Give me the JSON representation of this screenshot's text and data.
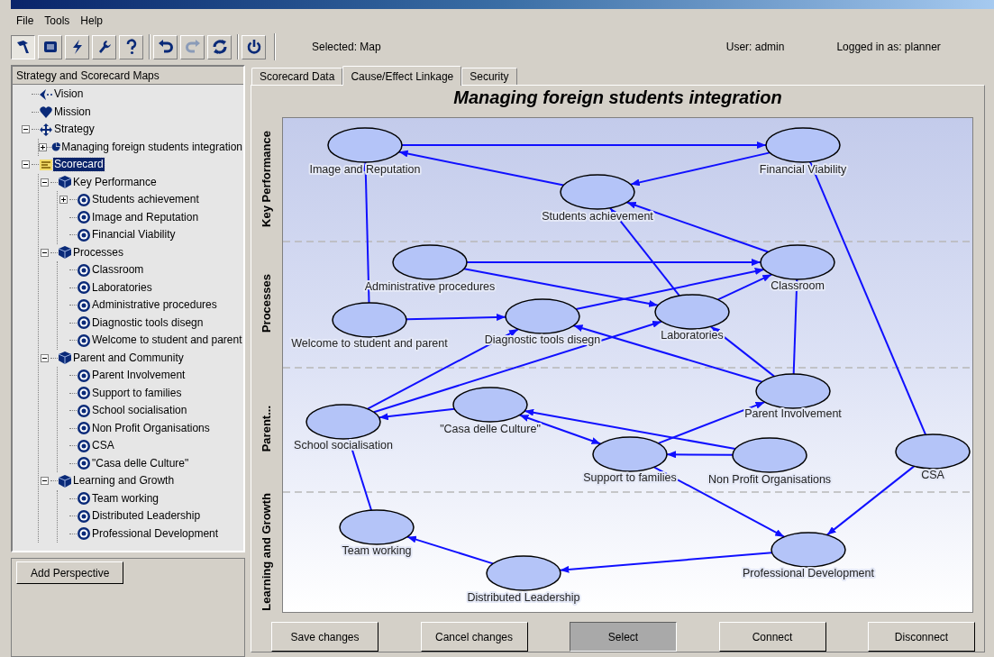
{
  "menu": [
    "File",
    "Tools",
    "Help"
  ],
  "toolbar": [
    {
      "kind": "hammer",
      "selected": true,
      "disabled": false
    },
    {
      "kind": "list",
      "selected": false,
      "disabled": false
    },
    {
      "kind": "bolt",
      "selected": false,
      "disabled": false
    },
    {
      "kind": "wrench",
      "selected": false,
      "disabled": false
    },
    {
      "kind": "help",
      "selected": false,
      "disabled": false
    },
    {
      "kind": "undo",
      "selected": false,
      "disabled": false
    },
    {
      "kind": "redo",
      "selected": false,
      "disabled": true
    },
    {
      "kind": "refresh",
      "selected": false,
      "disabled": false
    },
    {
      "kind": "power",
      "selected": false,
      "disabled": false
    }
  ],
  "status": {
    "selected": "Selected: Map",
    "user": "User: admin",
    "logged_in": "Logged in as: planner"
  },
  "sidebar": {
    "title": "Strategy and Scorecard Maps",
    "tree": [
      {
        "label": "Vision",
        "kind": "vision",
        "selected": false
      },
      {
        "label": "Mission",
        "kind": "mission",
        "selected": false
      },
      {
        "label": "Strategy",
        "kind": "strategy",
        "selected": false,
        "expanded": true,
        "children": [
          {
            "label": "Managing foreign students integration",
            "kind": "map",
            "selected": false,
            "expanded": false
          }
        ]
      },
      {
        "label": "Scorecard",
        "kind": "scorecard",
        "selected": true,
        "expanded": true,
        "children": [
          {
            "label": "Key Performance",
            "kind": "perspective",
            "selected": false,
            "expanded": true,
            "children": [
              {
                "label": "Students achievement",
                "kind": "objective",
                "selected": false,
                "expanded": false
              },
              {
                "label": "Image and Reputation",
                "kind": "objective",
                "selected": false
              },
              {
                "label": "Financial Viability",
                "kind": "objective",
                "selected": false
              }
            ]
          },
          {
            "label": "Processes",
            "kind": "perspective",
            "selected": false,
            "expanded": true,
            "children": [
              {
                "label": "Classroom",
                "kind": "objective",
                "selected": false
              },
              {
                "label": "Laboratories",
                "kind": "objective",
                "selected": false
              },
              {
                "label": "Administrative procedures",
                "kind": "objective",
                "selected": false
              },
              {
                "label": "Diagnostic tools disegn",
                "kind": "objective",
                "selected": false
              },
              {
                "label": "Welcome to student and parent",
                "kind": "objective",
                "selected": false
              }
            ]
          },
          {
            "label": "Parent and Community",
            "kind": "perspective",
            "selected": false,
            "expanded": true,
            "children": [
              {
                "label": "Parent Involvement",
                "kind": "objective",
                "selected": false
              },
              {
                "label": "Support to families",
                "kind": "objective",
                "selected": false
              },
              {
                "label": "School socialisation",
                "kind": "objective",
                "selected": false
              },
              {
                "label": "Non Profit Organisations",
                "kind": "objective",
                "selected": false
              },
              {
                "label": "CSA",
                "kind": "objective",
                "selected": false
              },
              {
                "label": "\"Casa delle Culture\"",
                "kind": "objective",
                "selected": false
              }
            ]
          },
          {
            "label": "Learning and Growth",
            "kind": "perspective",
            "selected": false,
            "expanded": true,
            "children": [
              {
                "label": "Team working",
                "kind": "objective",
                "selected": false
              },
              {
                "label": "Distributed Leadership",
                "kind": "objective",
                "selected": false
              },
              {
                "label": "Professional Development",
                "kind": "objective",
                "selected": false
              }
            ]
          }
        ]
      }
    ],
    "add_button": "Add Perspective"
  },
  "tabs": [
    {
      "label": "Scorecard Data",
      "selected": false
    },
    {
      "label": "Cause/Effect Linkage",
      "selected": true
    },
    {
      "label": "Security",
      "selected": false
    }
  ],
  "map": {
    "title": "Managing foreign students integration",
    "lanes": [
      "Key Performance",
      "Processes",
      "Parent...",
      "Learning and Growth"
    ],
    "nodes": [
      "Image and Reputation",
      "Financial Viability",
      "Students achievement",
      "Administrative procedures",
      "Classroom",
      "Welcome to student and parent",
      "Diagnostic tools disegn",
      "Laboratories",
      "Parent Involvement",
      "\"Casa delle Culture\"",
      "School socialisation",
      "Support to families",
      "Non Profit Organisations",
      "CSA",
      "Team working",
      "Professional Development",
      "Distributed Leadership"
    ]
  },
  "buttons": [
    {
      "label": "Save changes",
      "selected": false
    },
    {
      "label": "Cancel changes",
      "selected": false
    },
    {
      "label": "Select",
      "selected": true
    },
    {
      "label": "Connect",
      "selected": false
    },
    {
      "label": "Disconnect",
      "selected": false
    }
  ]
}
